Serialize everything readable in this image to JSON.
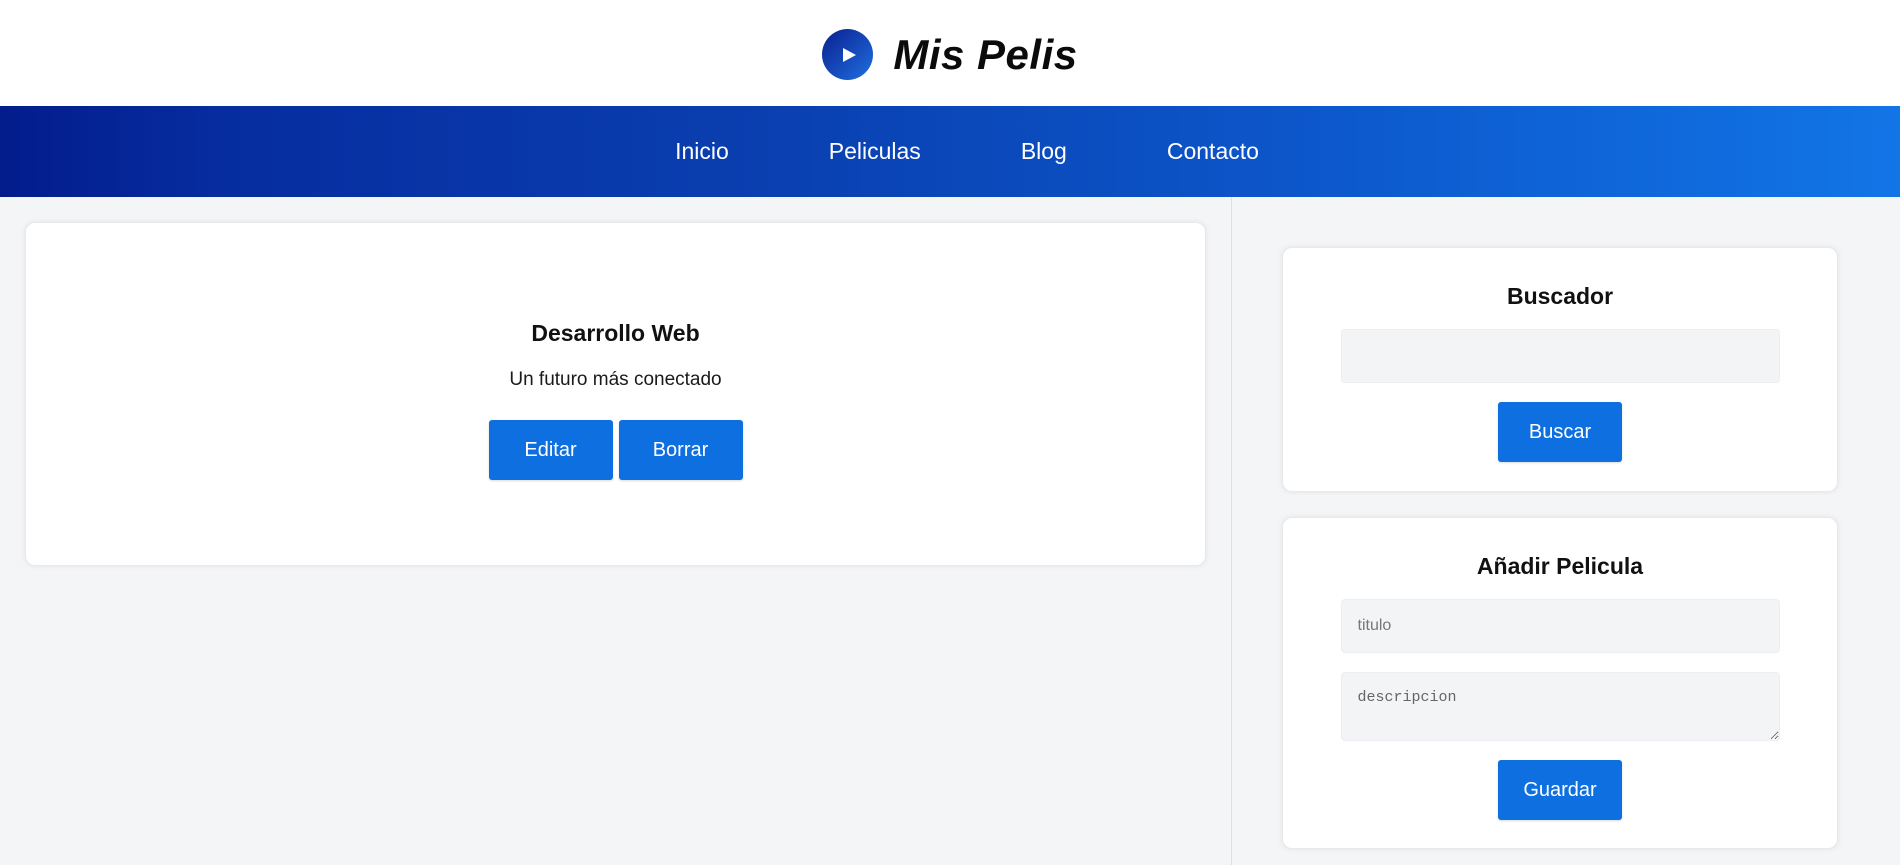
{
  "header": {
    "logo_icon": "play-icon",
    "title": "Mis Pelis"
  },
  "nav": {
    "items": [
      {
        "label": "Inicio"
      },
      {
        "label": "Peliculas"
      },
      {
        "label": "Blog"
      },
      {
        "label": "Contacto"
      }
    ]
  },
  "article": {
    "title": "Desarrollo Web",
    "description": "Un futuro más conectado",
    "edit_label": "Editar",
    "delete_label": "Borrar"
  },
  "search": {
    "title": "Buscador",
    "value": "",
    "button_label": "Buscar"
  },
  "add_movie": {
    "title": "Añadir Pelicula",
    "title_placeholder": "titulo",
    "description_placeholder": "descripcion",
    "button_label": "Guardar"
  },
  "colors": {
    "primary_button": "#0d6fe0",
    "nav_gradient_start": "#031c8c",
    "nav_gradient_end": "#1275e6",
    "background": "#f4f5f7"
  }
}
